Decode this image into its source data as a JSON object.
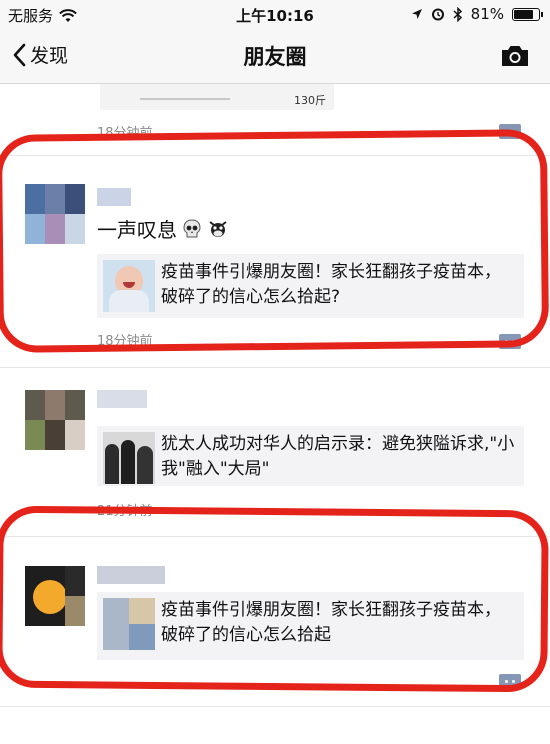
{
  "status_bar": {
    "carrier": "无服务",
    "time": "上午10:16",
    "battery": "81%",
    "battery_level": 0.81
  },
  "nav": {
    "back_label": "发现",
    "title": "朋友圈"
  },
  "feed": {
    "partial_post": {
      "image_text": "130斤",
      "time": "18分钟前"
    },
    "posts": [
      {
        "text": "一声叹息",
        "emojis": [
          "skull-emoji",
          "cow-emoji"
        ],
        "link_title": "疫苗事件引爆朋友圈！家长狂翻孩子疫苗本，破碎了的信心怎么拾起?",
        "time": "18分钟前"
      },
      {
        "link_title": "犹太人成功对华人的启示录：避免狭隘诉求,\"小我\"融入\"大局\"",
        "time": "21分钟前"
      },
      {
        "link_title": "疫苗事件引爆朋友圈！家长狂翻孩子疫苗本，破碎了的信心怎么拾起"
      }
    ]
  },
  "colors": {
    "annotation_red": "#e4231b",
    "comment_button": "#8696b5",
    "link_card_bg": "#f3f3f5",
    "timestamp": "#8c8c8c"
  }
}
